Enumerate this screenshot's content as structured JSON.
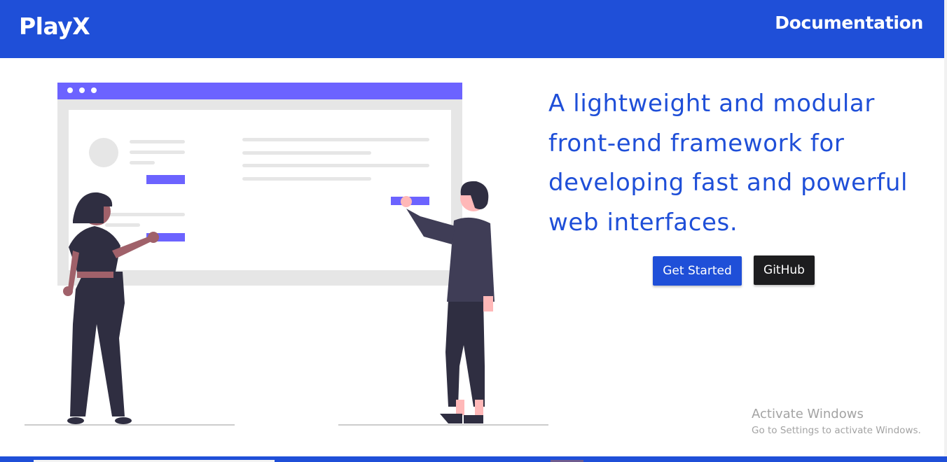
{
  "navbar": {
    "brand": "PlayX",
    "link": "Documentation",
    "color": "#1f4fd8"
  },
  "hero": {
    "headline": "A lightweight and modular front-end framework for developing fast and powerful web interfaces.",
    "buttons": {
      "primary": "Get Started",
      "secondary": "GitHub"
    },
    "illustration_icon": "people-building-web-interface-illustration"
  },
  "watermark": {
    "title": "Activate Windows",
    "subtitle": "Go to Settings to activate Windows."
  },
  "colors": {
    "brand_blue": "#1f4fd8",
    "accent_purple": "#6c63ff",
    "dark_button": "#1d1d1f"
  }
}
